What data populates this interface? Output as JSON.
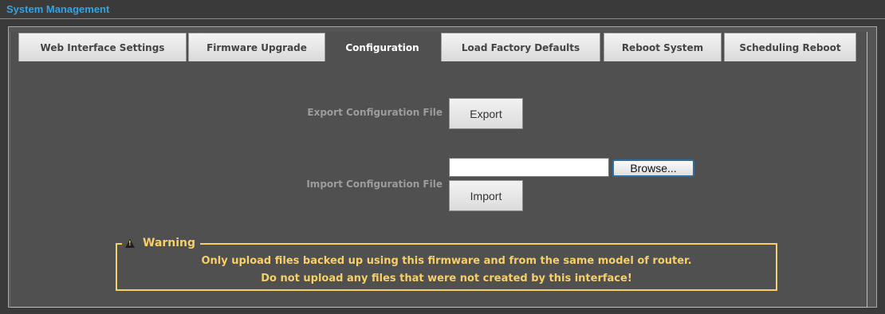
{
  "header": {
    "title": "System Management"
  },
  "tabs": [
    {
      "label": "Web Interface Settings",
      "active": false
    },
    {
      "label": "Firmware Upgrade",
      "active": false
    },
    {
      "label": "Configuration",
      "active": true
    },
    {
      "label": "Load Factory Defaults",
      "active": false
    },
    {
      "label": "Reboot System",
      "active": false
    },
    {
      "label": "Scheduling Reboot",
      "active": false
    }
  ],
  "export": {
    "label": "Export Configuration File",
    "button": "Export"
  },
  "import": {
    "label": "Import Configuration File",
    "file_value": "",
    "browse_button": "Browse...",
    "button": "Import"
  },
  "warning": {
    "title": "Warning",
    "line1": "Only upload files backed up using this firmware and from the same model of router.",
    "line2": "Do not upload any files that were not created by this interface!",
    "icon": "warning-triangle-icon"
  },
  "colors": {
    "accent": "#2fa5e6",
    "warning": "#f5cf6a",
    "panel": "#505050"
  }
}
